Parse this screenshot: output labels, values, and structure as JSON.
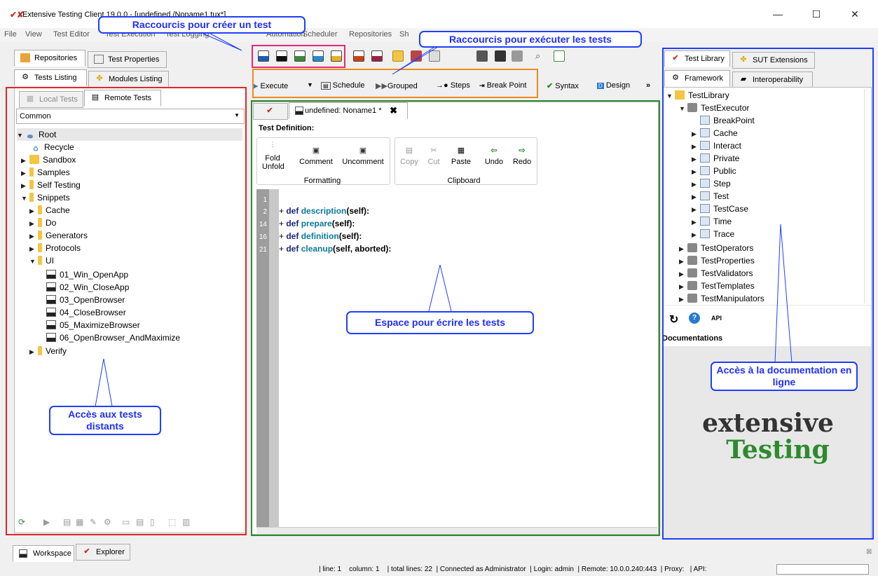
{
  "window": {
    "title": "Extensive Testing Client 19.0.0 - [undefined /Noname1.tux*]",
    "minimize": "—",
    "maximize": "☐",
    "close": "✕"
  },
  "menu": [
    "File",
    "View",
    "Test Editor",
    "Test Execution",
    "Test Logging",
    "Automation",
    "Scheduler",
    "Repositories",
    "Sh"
  ],
  "left": {
    "tabs_top": [
      "Repositories",
      "Test Properties"
    ],
    "tabs_second": [
      "Tests Listing",
      "Modules Listing"
    ],
    "tabs_third": [
      "Local Tests",
      "Remote Tests"
    ],
    "project": "Common",
    "tree": {
      "root": "Root",
      "recycle": "Recycle",
      "sandbox": "Sandbox",
      "samples": "Samples",
      "self_testing": "Self Testing",
      "snippets": "Snippets",
      "cache": "Cache",
      "do": "Do",
      "generators": "Generators",
      "protocols": "Protocols",
      "ui": "UI",
      "t1": "01_Win_OpenApp",
      "t2": "02_Win_CloseApp",
      "t3": "03_OpenBrowser",
      "t4": "04_CloseBrowser",
      "t5": "05_MaximizeBrowser",
      "t6": "06_OpenBrowser_AndMaximize",
      "verify": "Verify"
    }
  },
  "center": {
    "exec_toolbar": {
      "execute": "Execute",
      "schedule": "Schedule",
      "grouped": "Grouped",
      "steps": "Steps",
      "break_point": "Break Point",
      "syntax": "Syntax",
      "design": "Design",
      "more": "»"
    },
    "doc_tab": "undefined: Noname1 *",
    "test_definition": "Test Definition:",
    "formatting": {
      "fold": "Fold",
      "unfold": "Unfold",
      "comment": "Comment",
      "uncomment": "Uncomment",
      "group": "Formatting"
    },
    "clipboard": {
      "copy": "Copy",
      "cut": "Cut",
      "paste": "Paste",
      "undo": "Undo",
      "redo": "Redo",
      "group": "Clipboard"
    },
    "code": {
      "l1num": "1",
      "l2num": "2",
      "l3num": "14",
      "l4num": "16",
      "l5num": "21",
      "l2": [
        "+ ",
        "def ",
        "description",
        "(self):"
      ],
      "l3": [
        "+ ",
        "def ",
        "prepare",
        "(self):"
      ],
      "l4": [
        "+ ",
        "def ",
        "definition",
        "(self):"
      ],
      "l5": [
        "+ ",
        "def ",
        "cleanup",
        "(self, aborted):"
      ]
    }
  },
  "right": {
    "tabs_top": [
      "Test Library",
      "SUT Extensions"
    ],
    "tabs_second": [
      "Framework",
      "Interoperability"
    ],
    "tree": {
      "lib": "TestLibrary",
      "exec": "TestExecutor",
      "bp": "BreakPoint",
      "cache": "Cache",
      "interact": "Interact",
      "private": "Private",
      "public": "Public",
      "step": "Step",
      "test": "Test",
      "testcase": "TestCase",
      "time": "Time",
      "trace": "Trace",
      "ops": "TestOperators",
      "props": "TestProperties",
      "validators": "TestValidators",
      "templates": "TestTemplates",
      "manip": "TestManipulators"
    },
    "api": "API",
    "documentations": "Documentations",
    "logo_top": "extensive",
    "logo_bottom": "Testing"
  },
  "bottom": {
    "tabs": [
      "Workspace",
      "Explorer"
    ],
    "status": "| line: 1    column: 1    | total lines: 22  | Connected as Administrator  | Login: admin  | Remote: 10.0.0.240:443  | Proxy:   | API:"
  },
  "callouts": {
    "create": "Raccourcis pour créer un test",
    "execute": "Raccourcis pour exécuter les tests",
    "write": "Espace pour écrire les tests",
    "remote": "Accès aux tests distants",
    "docs": "Accès à la documentation en ligne"
  },
  "colors": {
    "red": "#e0262e",
    "green": "#2e8a2e",
    "blue": "#1f3fff",
    "orange": "#f08a1a",
    "pink": "#e0297a"
  }
}
